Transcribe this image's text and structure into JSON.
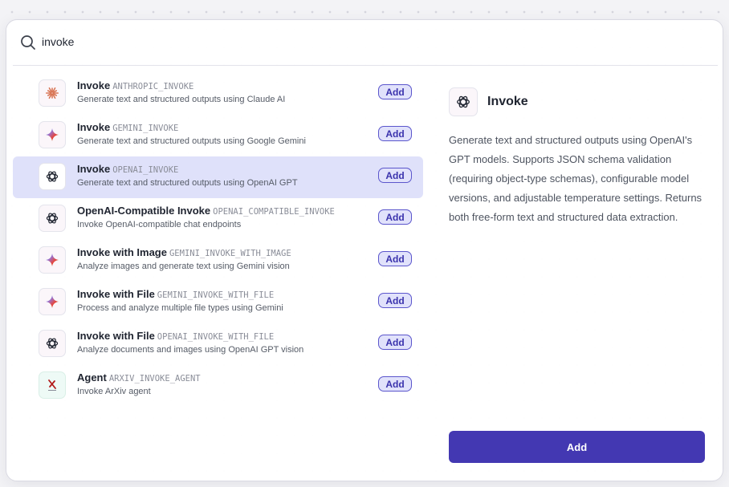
{
  "search": {
    "value": "invoke",
    "placeholder": ""
  },
  "items": [
    {
      "title": "Invoke",
      "code": "ANTHROPIC_INVOKE",
      "desc": "Generate text and structured outputs using Claude AI",
      "icon": "anthropic-icon",
      "add_label": "Add"
    },
    {
      "title": "Invoke",
      "code": "GEMINI_INVOKE",
      "desc": "Generate text and structured outputs using Google Gemini",
      "icon": "gemini-icon",
      "add_label": "Add"
    },
    {
      "title": "Invoke",
      "code": "OPENAI_INVOKE",
      "desc": "Generate text and structured outputs using OpenAI GPT",
      "icon": "openai-icon",
      "add_label": "Add",
      "selected": true
    },
    {
      "title": "OpenAI-Compatible Invoke",
      "code": "OPENAI_COMPATIBLE_INVOKE",
      "desc": "Invoke OpenAI-compatible chat endpoints",
      "icon": "openai-icon",
      "add_label": "Add"
    },
    {
      "title": "Invoke with Image",
      "code": "GEMINI_INVOKE_WITH_IMAGE",
      "desc": "Analyze images and generate text using Gemini vision",
      "icon": "gemini-icon",
      "add_label": "Add"
    },
    {
      "title": "Invoke with File",
      "code": "GEMINI_INVOKE_WITH_FILE",
      "desc": "Process and analyze multiple file types using Gemini",
      "icon": "gemini-icon",
      "add_label": "Add"
    },
    {
      "title": "Invoke with File",
      "code": "OPENAI_INVOKE_WITH_FILE",
      "desc": "Analyze documents and images using OpenAI GPT vision",
      "icon": "openai-icon",
      "add_label": "Add"
    },
    {
      "title": "Agent",
      "code": "ARXIV_INVOKE_AGENT",
      "desc": "Invoke ArXiv agent",
      "icon": "arxiv-icon",
      "add_label": "Add"
    }
  ],
  "detail": {
    "title": "Invoke",
    "icon": "openai-icon",
    "description": "Generate text and structured outputs using OpenAI's GPT models. Supports JSON schema validation (requiring object-type schemas), configurable model versions, and adjustable temperature settings. Returns both free-form text and structured data extraction."
  },
  "primary_button": {
    "label": "Add"
  },
  "colors": {
    "accent": "#4338b2",
    "selected_row": "#dfe1fa",
    "pill_bg": "#e1e2fb",
    "anthropic": "#d97757",
    "arxiv": "#b31b1b"
  }
}
